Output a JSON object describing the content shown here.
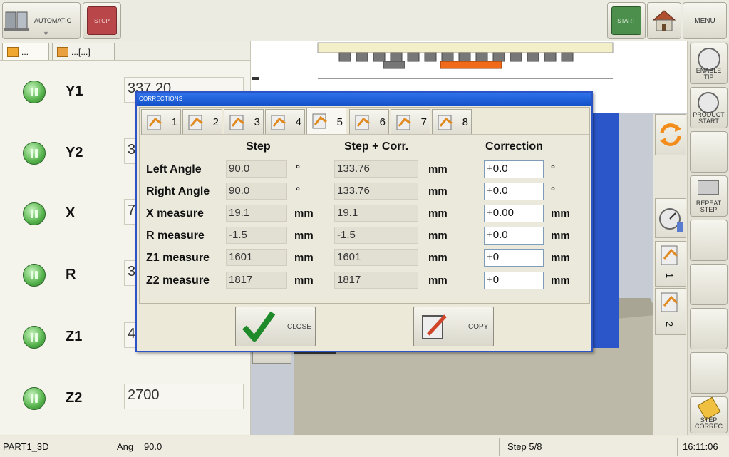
{
  "topbar": {
    "mode_label": "AUTOMATIC",
    "stop_label": "STOP",
    "start_label": "START",
    "menu_label": "MENU"
  },
  "left_tabs": [
    {
      "label": "..."
    },
    {
      "label": "...[...]"
    }
  ],
  "axes": [
    {
      "name": "Y1",
      "value": "337.20"
    },
    {
      "name": "Y2",
      "value": "3"
    },
    {
      "name": "X",
      "value": "7"
    },
    {
      "name": "R",
      "value": "3"
    },
    {
      "name": "Z1",
      "value": "4"
    },
    {
      "name": "Z2",
      "value": "2700"
    }
  ],
  "right_toolbar": {
    "enable_tip": "ENABLE TIP",
    "product_start": "PRODUCT START",
    "repeat_step": "REPEAT STEP",
    "step_correc": "STEP CORREC",
    "mini_1": "1",
    "mini_2": "2"
  },
  "status": {
    "part": "PART1_3D",
    "angle": "Ang = 90.0",
    "step": "Step 5/8",
    "time": "16:11:06"
  },
  "dialog": {
    "title": "CORRECTIONS",
    "tabs": [
      "1",
      "2",
      "3",
      "4",
      "5",
      "6",
      "7",
      "8"
    ],
    "active_tab": 5,
    "headers": {
      "step": "Step",
      "step_corr": "Step + Corr.",
      "correction": "Correction"
    },
    "rows": [
      {
        "label": "Left Angle",
        "step": "90.0",
        "step_unit": "°",
        "step_corr": "133.76",
        "sc_unit": "mm",
        "correction": "+0.0",
        "corr_unit": "°"
      },
      {
        "label": "Right Angle",
        "step": "90.0",
        "step_unit": "°",
        "step_corr": "133.76",
        "sc_unit": "mm",
        "correction": "+0.0",
        "corr_unit": "°"
      },
      {
        "label": "X measure",
        "step": "19.1",
        "step_unit": "mm",
        "step_corr": "19.1",
        "sc_unit": "mm",
        "correction": "+0.00",
        "corr_unit": "mm"
      },
      {
        "label": "R measure",
        "step": "-1.5",
        "step_unit": "mm",
        "step_corr": "-1.5",
        "sc_unit": "mm",
        "correction": "+0.0",
        "corr_unit": "mm"
      },
      {
        "label": "Z1 measure",
        "step": "1601",
        "step_unit": "mm",
        "step_corr": "1601",
        "sc_unit": "mm",
        "correction": "+0",
        "corr_unit": "mm"
      },
      {
        "label": "Z2 measure",
        "step": "1817",
        "step_unit": "mm",
        "step_corr": "1817",
        "sc_unit": "mm",
        "correction": "+0",
        "corr_unit": "mm"
      }
    ],
    "close_label": "CLOSE",
    "copy_label": "COPY"
  }
}
